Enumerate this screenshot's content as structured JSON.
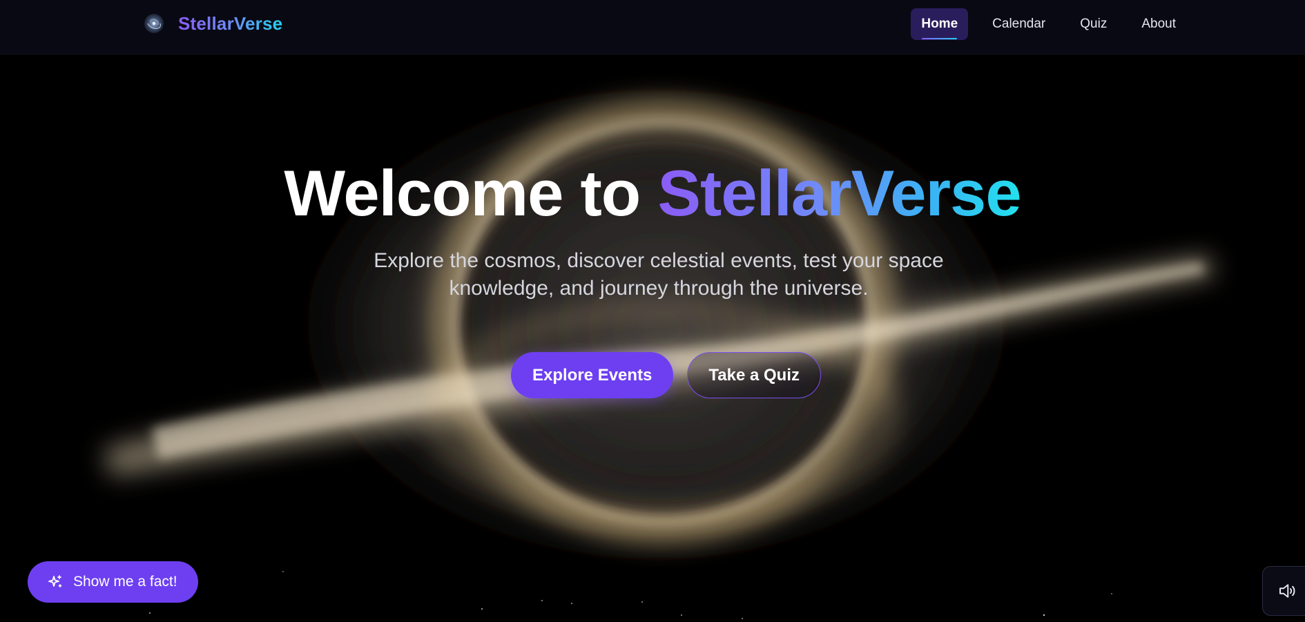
{
  "brand": {
    "name": "StellarVerse"
  },
  "nav": {
    "links": [
      {
        "label": "Home",
        "active": true
      },
      {
        "label": "Calendar",
        "active": false
      },
      {
        "label": "Quiz",
        "active": false
      },
      {
        "label": "About",
        "active": false
      }
    ]
  },
  "hero": {
    "title_prefix": "Welcome to ",
    "title_highlight": "StellarVerse",
    "subtitle_line1": "Explore the cosmos, discover celestial events, test your space",
    "subtitle_line2": "knowledge, and journey through the universe.",
    "primary_button": "Explore Events",
    "secondary_button": "Take a Quiz"
  },
  "widgets": {
    "fact_button": "Show me a fact!",
    "sound_icon": "volume-icon"
  },
  "colors": {
    "accent": "#6d3ff1",
    "gradient_start": "#8b5cf6",
    "gradient_end": "#22d3ee",
    "nav_active_bg": "#2a1d5c",
    "background": "#000000"
  },
  "icons": {
    "brand_logo": "galaxy-icon",
    "fact_button_icon": "sparkles-icon",
    "sound_button_icon": "volume-icon"
  }
}
